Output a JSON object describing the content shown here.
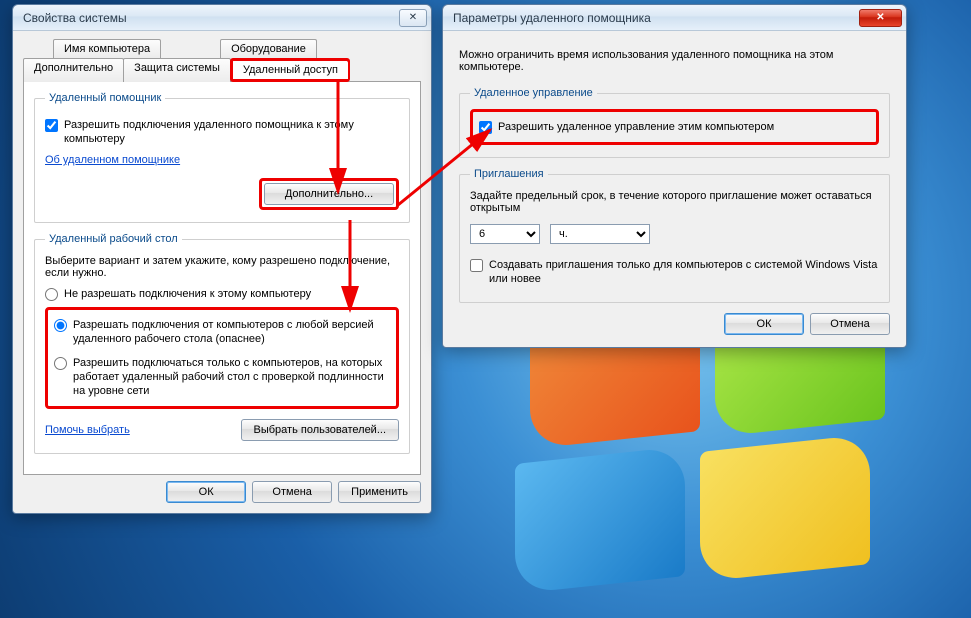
{
  "window1": {
    "title": "Свойства системы",
    "tabs": {
      "row1": [
        "Имя компьютера",
        "Оборудование"
      ],
      "row2": [
        "Дополнительно",
        "Защита системы",
        "Удаленный доступ"
      ]
    },
    "group_remote_assist": {
      "legend": "Удаленный помощник",
      "checkbox_label": "Разрешить подключения удаленного помощника к этому компьютеру",
      "link": "Об удаленном помощнике",
      "advanced_btn": "Дополнительно..."
    },
    "group_remote_desktop": {
      "legend": "Удаленный рабочий стол",
      "instruction": "Выберите вариант и затем укажите, кому разрешено подключение, если нужно.",
      "radio1": "Не разрешать подключения к этому компьютеру",
      "radio2": "Разрешать подключения от компьютеров с любой версией удаленного рабочего стола (опаснее)",
      "radio3": "Разрешить подключаться только с компьютеров, на которых работает удаленный рабочий стол с проверкой подлинности на уровне сети",
      "help_link": "Помочь выбрать",
      "select_users_btn": "Выбрать пользователей..."
    },
    "buttons": {
      "ok": "ОК",
      "cancel": "Отмена",
      "apply": "Применить"
    }
  },
  "window2": {
    "title": "Параметры удаленного помощника",
    "intro": "Можно ограничить время использования удаленного помощника на этом компьютере.",
    "group_control": {
      "legend": "Удаленное управление",
      "checkbox_label": "Разрешить удаленное управление этим компьютером"
    },
    "group_invite": {
      "legend": "Приглашения",
      "instruction": "Задайте предельный срок, в течение которого приглашение может оставаться открытым",
      "number_value": "6",
      "unit_value": "ч.",
      "vista_label": "Создавать приглашения только для компьютеров с системой Windows Vista или новее"
    },
    "buttons": {
      "ok": "ОК",
      "cancel": "Отмена"
    }
  }
}
